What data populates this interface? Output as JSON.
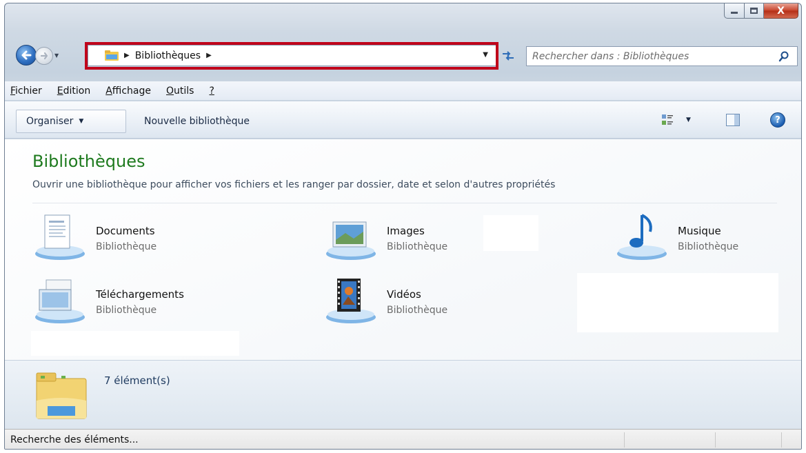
{
  "window": {
    "caption": {
      "close_label": "X"
    }
  },
  "navigation": {
    "breadcrumb": [
      "Bibliothèques"
    ],
    "search_placeholder": "Rechercher dans : Bibliothèques"
  },
  "menubar": {
    "items": [
      {
        "underline": "F",
        "rest": "ichier"
      },
      {
        "underline": "E",
        "rest": "dition"
      },
      {
        "underline": "A",
        "rest": "ffichage"
      },
      {
        "underline": "O",
        "rest": "utils"
      },
      {
        "underline": "?",
        "rest": ""
      }
    ]
  },
  "commandbar": {
    "organize_label": "Organiser",
    "new_library_label": "Nouvelle bibliothèque",
    "help_label": "?"
  },
  "content": {
    "title": "Bibliothèques",
    "subtitle": "Ouvrir une bibliothèque pour afficher vos fichiers et les ranger par dossier, date et selon d'autres propriétés",
    "libraries": [
      {
        "name": "Documents",
        "type": "Bibliothèque",
        "icon": "documents-library-icon"
      },
      {
        "name": "Images",
        "type": "Bibliothèque",
        "icon": "images-library-icon"
      },
      {
        "name": "Musique",
        "type": "Bibliothèque",
        "icon": "music-library-icon"
      },
      {
        "name": "Téléchargements",
        "type": "Bibliothèque",
        "icon": "downloads-library-icon"
      },
      {
        "name": "Vidéos",
        "type": "Bibliothèque",
        "icon": "videos-library-icon"
      }
    ]
  },
  "details": {
    "count": "7 élément(s)"
  },
  "statusbar": {
    "text": "Recherche des éléments..."
  },
  "colors": {
    "title_green": "#1e7a1e",
    "highlight_red": "#c0001a"
  }
}
